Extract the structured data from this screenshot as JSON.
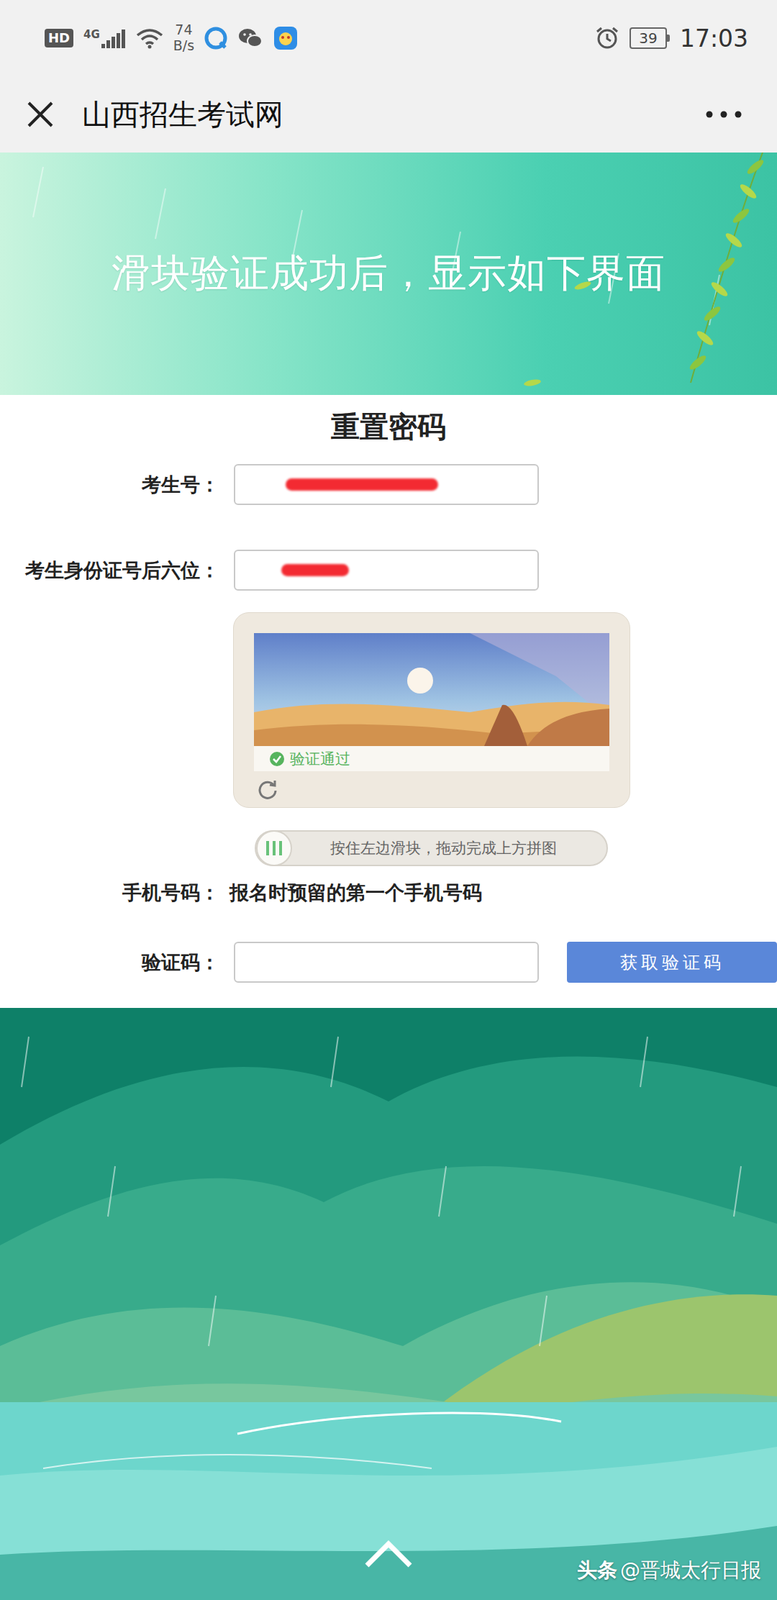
{
  "status_bar": {
    "hd": "HD",
    "network": "4G",
    "speed": "74",
    "speed_unit": "B/s",
    "battery": "39",
    "time": "17:03"
  },
  "title_bar": {
    "title": "山西招生考试网"
  },
  "banner": {
    "text": "滑块验证成功后，显示如下界面"
  },
  "form": {
    "title": "重置密码",
    "fields": [
      {
        "label": "考生号：",
        "value": "",
        "redacted": true
      },
      {
        "label": "考生身份证号后六位：",
        "value": "",
        "redacted": true
      }
    ],
    "captcha": {
      "status": "验证通过",
      "verified": true,
      "slider_hint": "按住左边滑块，拖动完成上方拼图",
      "level": 0
    },
    "phone": {
      "label": "手机号码：",
      "value": "报名时预留的第一个手机号码"
    },
    "code": {
      "label": "验证码：",
      "value": "",
      "button": "获取验证码"
    }
  },
  "watermark": {
    "source": "头条",
    "author": "@晋城太行日报"
  }
}
